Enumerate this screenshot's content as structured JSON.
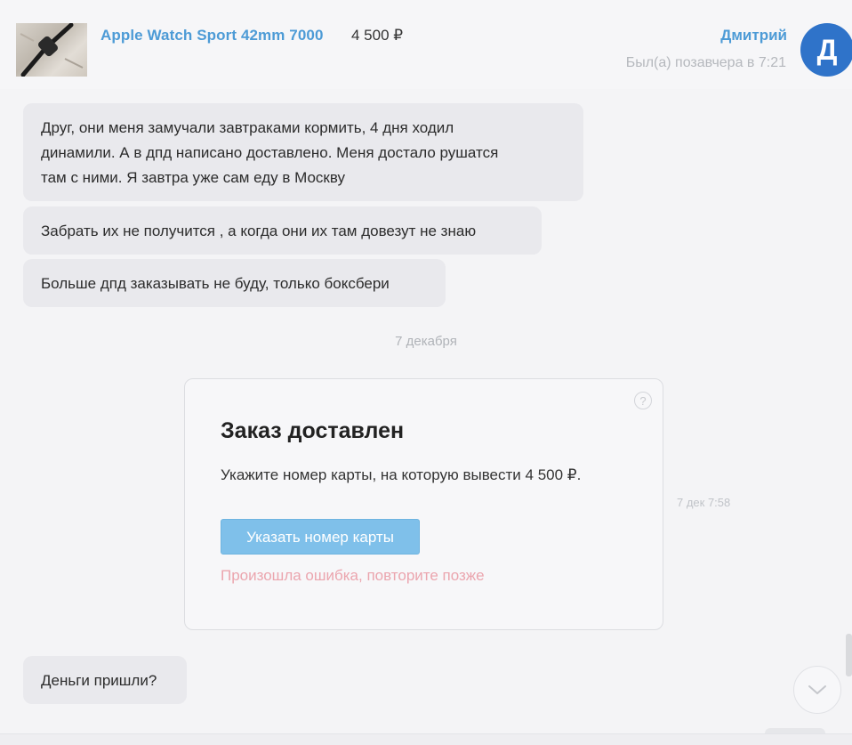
{
  "header": {
    "product_title": "Apple Watch Sport 42mm 7000",
    "product_price": "4 500 ₽",
    "seller_name": "Дмитрий",
    "last_seen": "Был(а) позавчера в 7:21",
    "avatar_letter": "Д",
    "avatar_color": "#2f73c9",
    "thumbnail_icon": "watch-photo"
  },
  "messages": [
    {
      "lines": [
        "Друг, они меня замучали завтраками кормить, 4 дня ходил",
        "динамили. А в дпд написано доставлено. Меня достало рушатся",
        "там с ними. Я завтра уже сам еду в Москву"
      ]
    },
    {
      "text": "Забрать их не получится , а когда они их там довезут не знаю"
    },
    {
      "text": "Больше дпд заказывать не буду, только боксбери"
    }
  ],
  "date_separator": "7 декабря",
  "order_card": {
    "help_icon": "?",
    "title": "Заказ доставлен",
    "text": "Укажите номер карты, на которую вывести 4 500 ₽.",
    "button_label": "Указать номер карты",
    "error_text": "Произошла ошибка, повторите позже",
    "time": "7 дек 7:58"
  },
  "last_message": {
    "text": "Деньги пришли?"
  },
  "colors": {
    "link": "#4d9bd6",
    "button": "#7fc0ea",
    "error": "#eba5ae",
    "bubble": "#e9e9ed"
  }
}
